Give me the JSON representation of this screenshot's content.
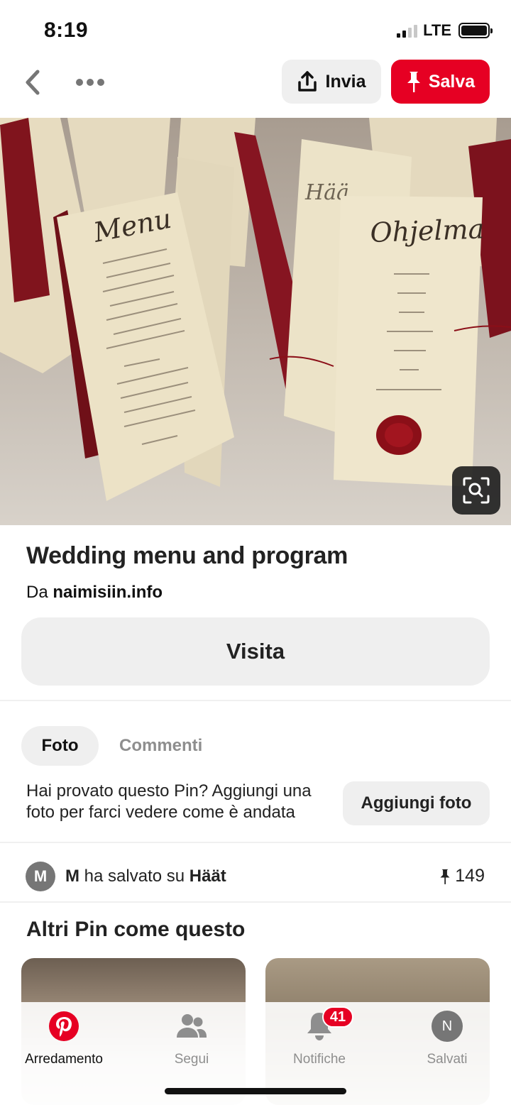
{
  "status_bar": {
    "time": "8:19",
    "network": "LTE",
    "signal_bars_filled": 2,
    "signal_bars_total": 4,
    "battery_level": 1.0
  },
  "toolbar": {
    "back_icon": "chevron-left-icon",
    "more_icon": "ellipsis-icon",
    "send_label": "Invia",
    "send_icon": "share-upload-icon",
    "save_label": "Salva",
    "save_icon": "pushpin-icon"
  },
  "hero": {
    "menu_card_heading": "Menu",
    "program_card_heading": "Ohjelma",
    "lens_icon": "visual-search-icon"
  },
  "pin": {
    "title": "Wedding menu and program",
    "source_prefix": "Da",
    "source_domain": "naimisiin.info",
    "visit_label": "Visita"
  },
  "tabs": [
    {
      "label": "Foto",
      "active": true
    },
    {
      "label": "Commenti",
      "active": false
    }
  ],
  "tried": {
    "text": "Hai provato questo Pin? Aggiungi una foto per farci vedere come è andata",
    "button_label": "Aggiungi foto"
  },
  "saved_by": {
    "avatar_initial": "M",
    "user": "M",
    "middle_text": "ha salvato su",
    "board": "Häät",
    "count": "149"
  },
  "more_like_this": {
    "title": "Altri Pin come questo"
  },
  "bottom_nav": [
    {
      "label": "Arredamento",
      "icon": "pinterest-logo-icon",
      "active": true
    },
    {
      "label": "Segui",
      "icon": "people-icon",
      "active": false
    },
    {
      "label": "Notifiche",
      "icon": "bell-icon",
      "active": false,
      "badge": "41"
    },
    {
      "label": "Salvati",
      "icon": "profile-avatar-icon",
      "active": false,
      "avatar_initial": "N"
    }
  ],
  "colors": {
    "brand_red": "#e60023",
    "button_gray": "#efefef",
    "secondary_text": "#8e8e8e"
  }
}
